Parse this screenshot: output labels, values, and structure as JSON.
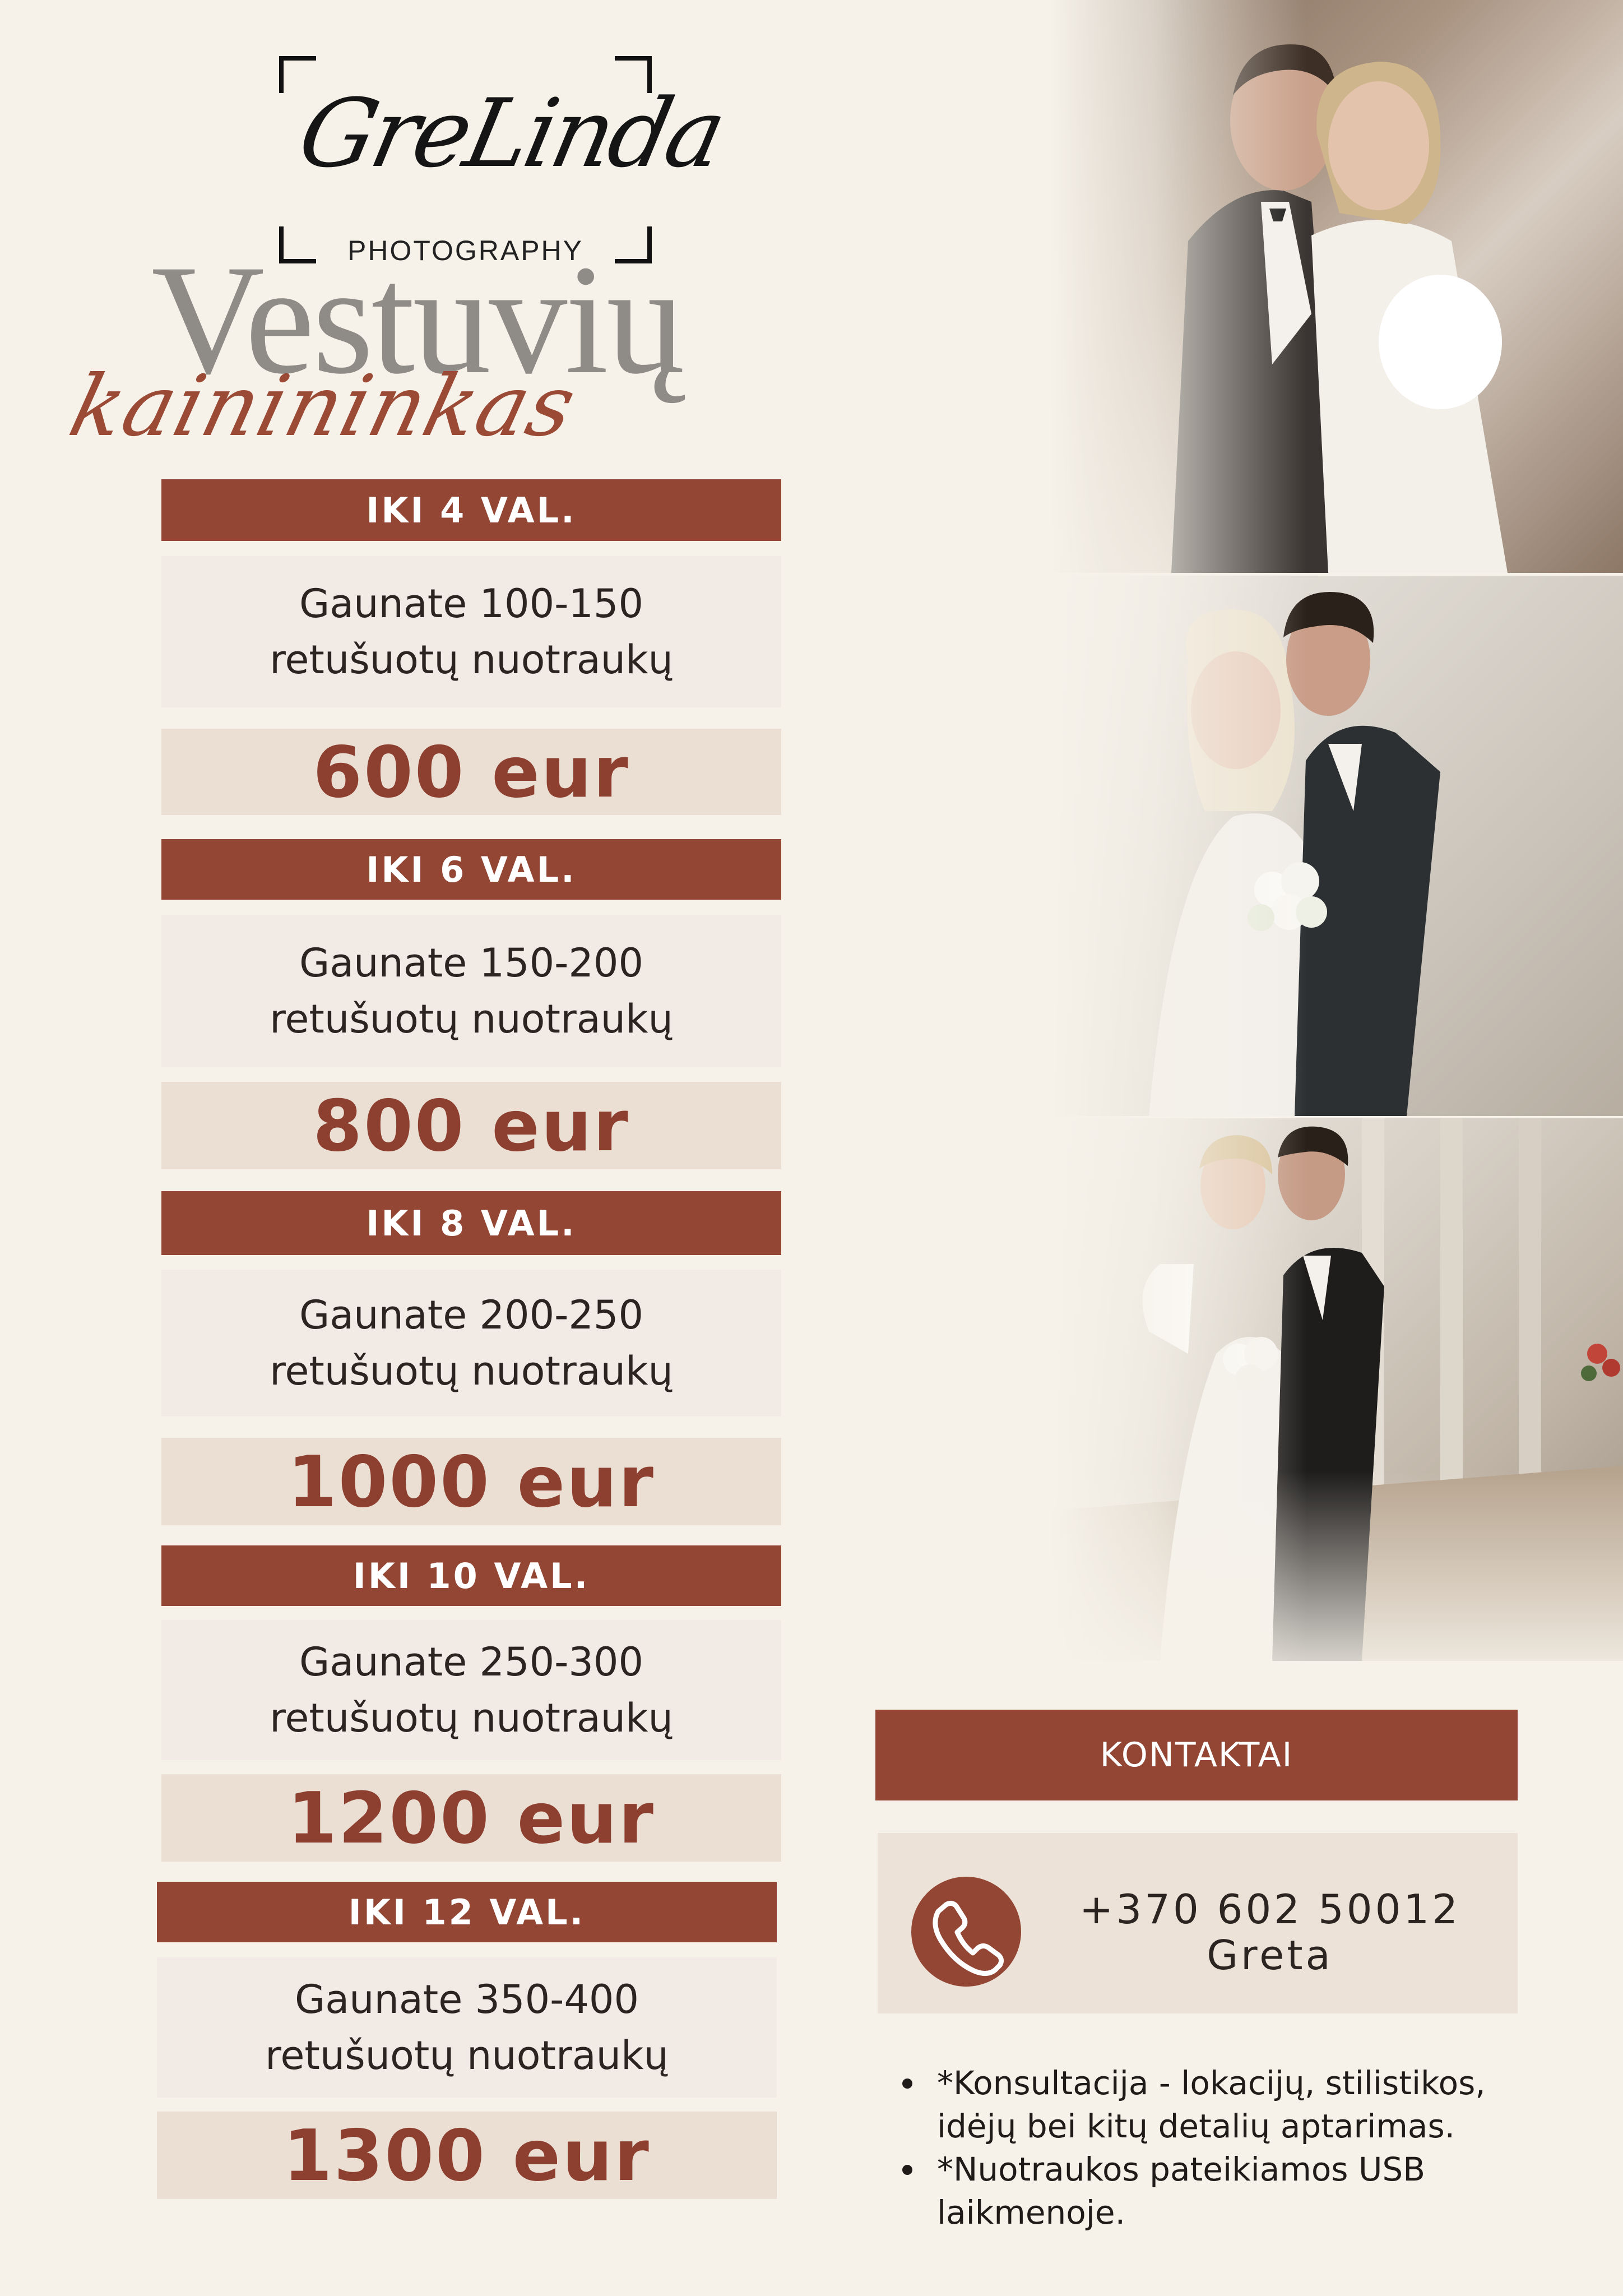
{
  "logo": {
    "script": "GreLinda",
    "subtitle": "PHOTOGRAPHY"
  },
  "title": {
    "main": "Vestuvių",
    "script": "kainininkas"
  },
  "packages": [
    {
      "duration": "IKI 4 VAL.",
      "line1": "Gaunate 100-150",
      "line2": "retušuotų nuotraukų",
      "price": "600 eur"
    },
    {
      "duration": "IKI 6 VAL.",
      "line1": "Gaunate 150-200",
      "line2": "retušuotų nuotraukų",
      "price": "800 eur"
    },
    {
      "duration": "IKI 8 VAL.",
      "line1": "Gaunate 200-250",
      "line2": "retušuotų nuotraukų",
      "price": "1000 eur"
    },
    {
      "duration": "IKI 10 VAL.",
      "line1": "Gaunate 250-300",
      "line2": "retušuotų nuotraukų",
      "price": "1200 eur"
    },
    {
      "duration": "IKI 12 VAL.",
      "line1": "Gaunate 350-400",
      "line2": "retušuotų nuotraukų",
      "price": "1300 eur"
    }
  ],
  "contacts": {
    "header": "KONTAKTAI",
    "icon": "phone-icon",
    "phone": "+370 602 50012",
    "name": "Greta"
  },
  "notes": [
    "*Konsultacija - lokacijų, stilistikos, idėjų bei kitų detalių aptarimas.",
    "*Nuotraukos pateikiamos USB laikmenoje."
  ],
  "colors": {
    "background": "#f6f2ea",
    "accent": "#934634",
    "price_text": "#8d4030",
    "title_grey": "#8f8b86"
  }
}
